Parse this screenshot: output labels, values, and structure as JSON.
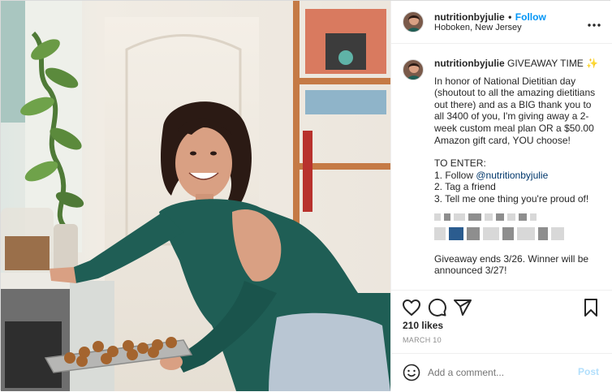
{
  "post": {
    "username": "nutritionbyjulie",
    "follow_separator": "•",
    "follow_label": "Follow",
    "location": "Hoboken, New Jersey",
    "more_icon": "more-horizontal-icon"
  },
  "caption": {
    "username": "nutritionbyjulie",
    "headline": "GIVEAWAY TIME",
    "sparkle": "✨",
    "body": "In honor of National Dietitian day (shoutout to all the amazing dietitians out there) and as a BIG thank you to all 3400 of you, I'm giving away a 2-week custom meal plan OR a $50.00 Amazon gift card, YOU choose!",
    "enter_heading": "TO ENTER:",
    "step1_prefix": "1. Follow ",
    "step1_mention": "@nutritionbyjulie",
    "step2": "2. Tag a friend",
    "step3": "3. Tell me one thing you're proud of!",
    "closing": "Giveaway ends 3/26. Winner will be announced 3/27!"
  },
  "engagement": {
    "likes": "210 likes",
    "date": "MARCH 10",
    "icons": [
      "heart-icon",
      "comment-icon",
      "share-icon",
      "bookmark-icon"
    ]
  },
  "comment": {
    "emoji_icon": "smiley-icon",
    "placeholder": "Add a comment...",
    "post_label": "Post"
  },
  "colors": {
    "link": "#0095f6",
    "post_disabled": "#b2dffc",
    "border": "#dbdbdb",
    "sweater": "#1f5e55"
  }
}
